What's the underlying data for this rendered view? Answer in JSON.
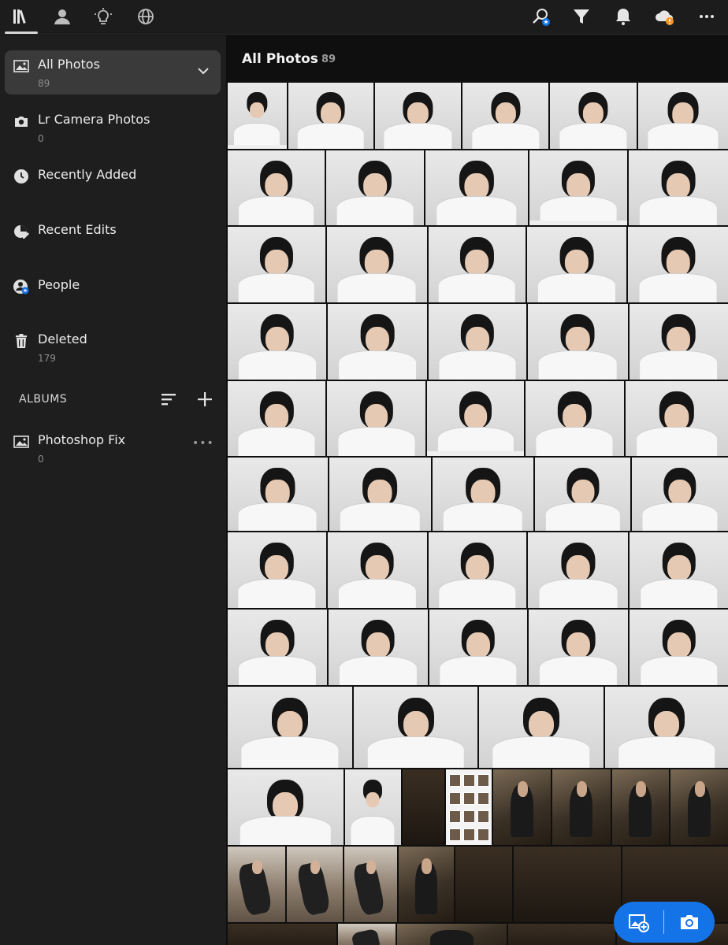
{
  "topbar": {
    "left_icons": [
      "library-icon",
      "people-icon",
      "learn-icon",
      "discover-icon"
    ],
    "right_icons": [
      "search-icon",
      "filter-icon",
      "notification-icon",
      "cloud-sync-icon",
      "more-icon"
    ],
    "accent_warning": "#f29423",
    "accent_blue": "#1473e6"
  },
  "sidebar": {
    "items": [
      {
        "label": "All Photos",
        "count": "89",
        "icon": "photos-icon"
      },
      {
        "label": "Lr Camera Photos",
        "count": "0",
        "icon": "camera-icon"
      },
      {
        "label": "Recently Added",
        "count": "",
        "icon": "clock-icon"
      },
      {
        "label": "Recent Edits",
        "count": "",
        "icon": "edits-icon"
      },
      {
        "label": "People",
        "count": "",
        "icon": "person-icon"
      },
      {
        "label": "Deleted",
        "count": "179",
        "icon": "trash-icon"
      }
    ],
    "albums_heading": "ALBUMS",
    "albums": [
      {
        "label": "Photoshop Fix",
        "count": "0",
        "icon": "album-icon"
      }
    ]
  },
  "main": {
    "title": "All Photos",
    "count": "89"
  }
}
